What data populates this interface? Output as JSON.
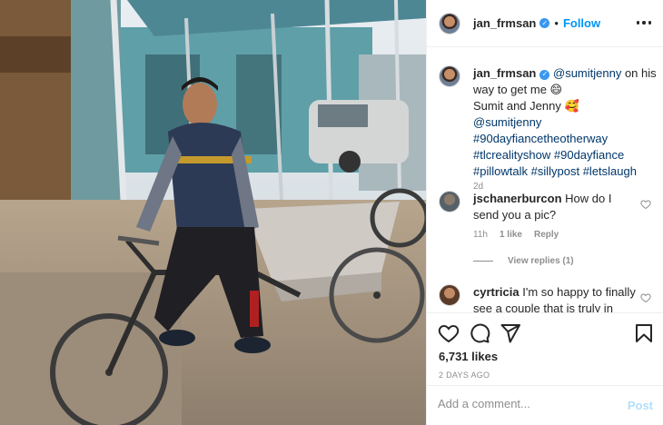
{
  "header": {
    "username": "jan_frmsan",
    "separator": "•",
    "follow_label": "Follow",
    "verified_icon": "verified-badge-icon",
    "more_icon": "more-options-icon"
  },
  "caption": {
    "username": "jan_frmsan",
    "mention": "@sumitjenny",
    "text_1": " on his way to get me 😄",
    "line_2": "Sumit and Jenny 🥰",
    "mention_2": "@sumitjenny",
    "hashtags": [
      "#90dayfiancetheotherway",
      "#tlcrealityshow",
      "#90dayfiance",
      "#pillowtalk",
      "#sillypost",
      "#letslaugh"
    ],
    "time": "2d"
  },
  "comments": [
    {
      "username": "jschanerburcon",
      "text": "How do I send you a pic?",
      "time": "11h",
      "likes": "1 like",
      "reply": "Reply",
      "view_replies": "View replies (1)"
    },
    {
      "username": "cyrtricia",
      "text": "I'm so happy to finally see a couple that is truly in love and"
    }
  ],
  "actions": {
    "likes": "6,731 likes",
    "date": "2 DAYS AGO",
    "icons": [
      "heart-icon",
      "comment-icon",
      "share-icon",
      "bookmark-icon"
    ]
  },
  "add_comment": {
    "placeholder": "Add a comment...",
    "post_label": "Post"
  },
  "colors": {
    "accent": "#0095f6",
    "link": "#00376b",
    "muted": "#8e8e8e",
    "post_disabled": "#b2dffc"
  }
}
